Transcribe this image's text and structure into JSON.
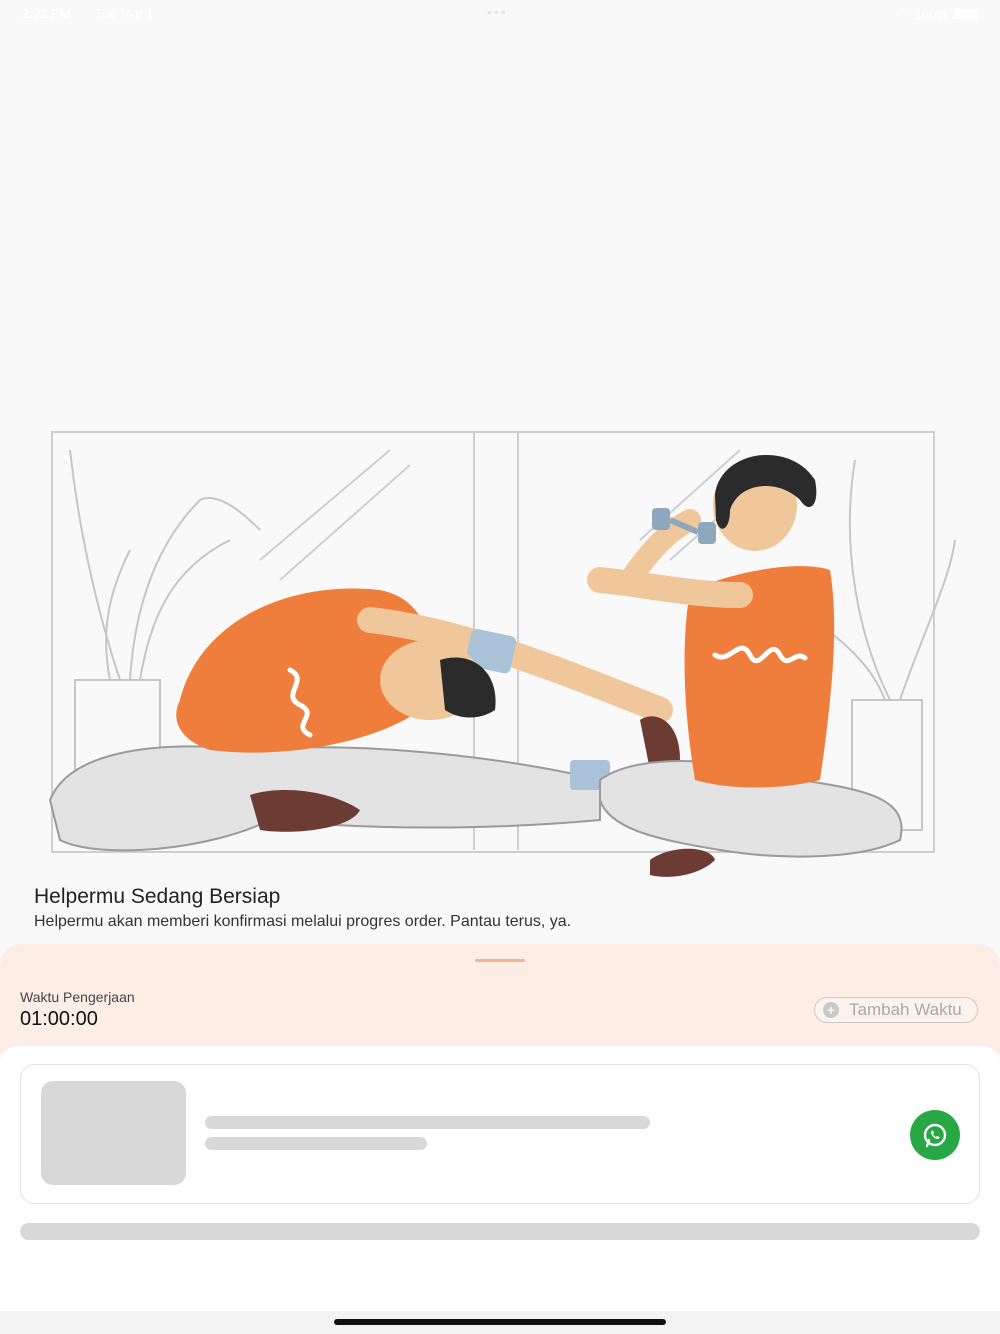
{
  "status_bar": {
    "time": "2:22 PM",
    "date": "Tue Mar 1",
    "battery": "100%"
  },
  "info": {
    "title": "Helpermu Sedang Bersiap",
    "subtitle": "Helpermu akan memberi konfirmasi melalui progres order. Pantau terus, ya."
  },
  "sheet": {
    "time_label": "Waktu Pengerjaan",
    "time_value": "01:00:00",
    "add_time_label": "Tambah Waktu"
  },
  "icons": {
    "whatsapp": "whatsapp-icon",
    "plus": "plus-circle-icon"
  },
  "colors": {
    "accent_orange": "#ef7d3b",
    "sheet_background": "#fdeee5",
    "whatsapp_green": "#28a745",
    "skeleton": "#d8d8d8"
  }
}
